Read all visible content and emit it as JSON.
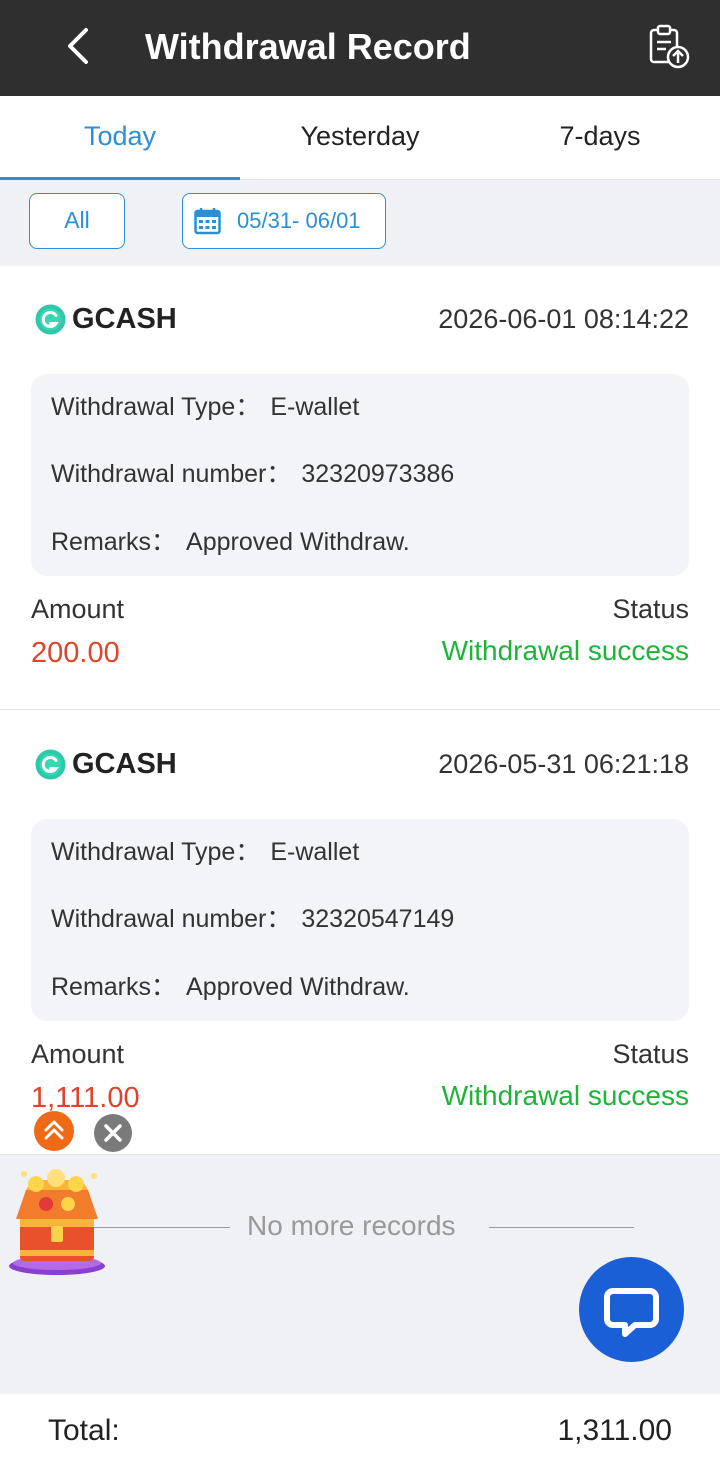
{
  "header": {
    "title": "Withdrawal Record"
  },
  "tabs": [
    {
      "label": "Today",
      "active": true
    },
    {
      "label": "Yesterday",
      "active": false
    },
    {
      "label": "7-days",
      "active": false
    }
  ],
  "filter": {
    "type_label": "All",
    "date_range": "05/31- 06/01"
  },
  "labels": {
    "withdrawal_type": "Withdrawal Type：",
    "withdrawal_number": "Withdrawal number：",
    "remarks": "Remarks：",
    "amount": "Amount",
    "status": "Status"
  },
  "records": [
    {
      "channel": "GCASH",
      "time": "2026-06-01 08:14:22",
      "type": "E-wallet",
      "number": "32320973386",
      "remarks": "Approved Withdraw.",
      "amount": "200.00",
      "status": "Withdrawal success"
    },
    {
      "channel": "GCASH",
      "time": "2026-05-31 06:21:18",
      "type": "E-wallet",
      "number": "32320547149",
      "remarks": "Approved Withdraw.",
      "amount": "1,111.00",
      "status": "Withdrawal success"
    }
  ],
  "no_more": "No more records",
  "footer": {
    "total_label": "Total:",
    "total_value": "1,311.00"
  },
  "colors": {
    "accent": "#2a8fd6",
    "amount": "#e0432c",
    "success": "#1fb33a",
    "header_bg": "#2f2f2f",
    "chat": "#1b5fd6"
  },
  "icons": [
    "back-arrow-icon",
    "upload-record-icon",
    "calendar-icon",
    "gcash-icon",
    "scroll-top-icon",
    "close-icon",
    "treasure-chest-icon",
    "chat-icon"
  ]
}
